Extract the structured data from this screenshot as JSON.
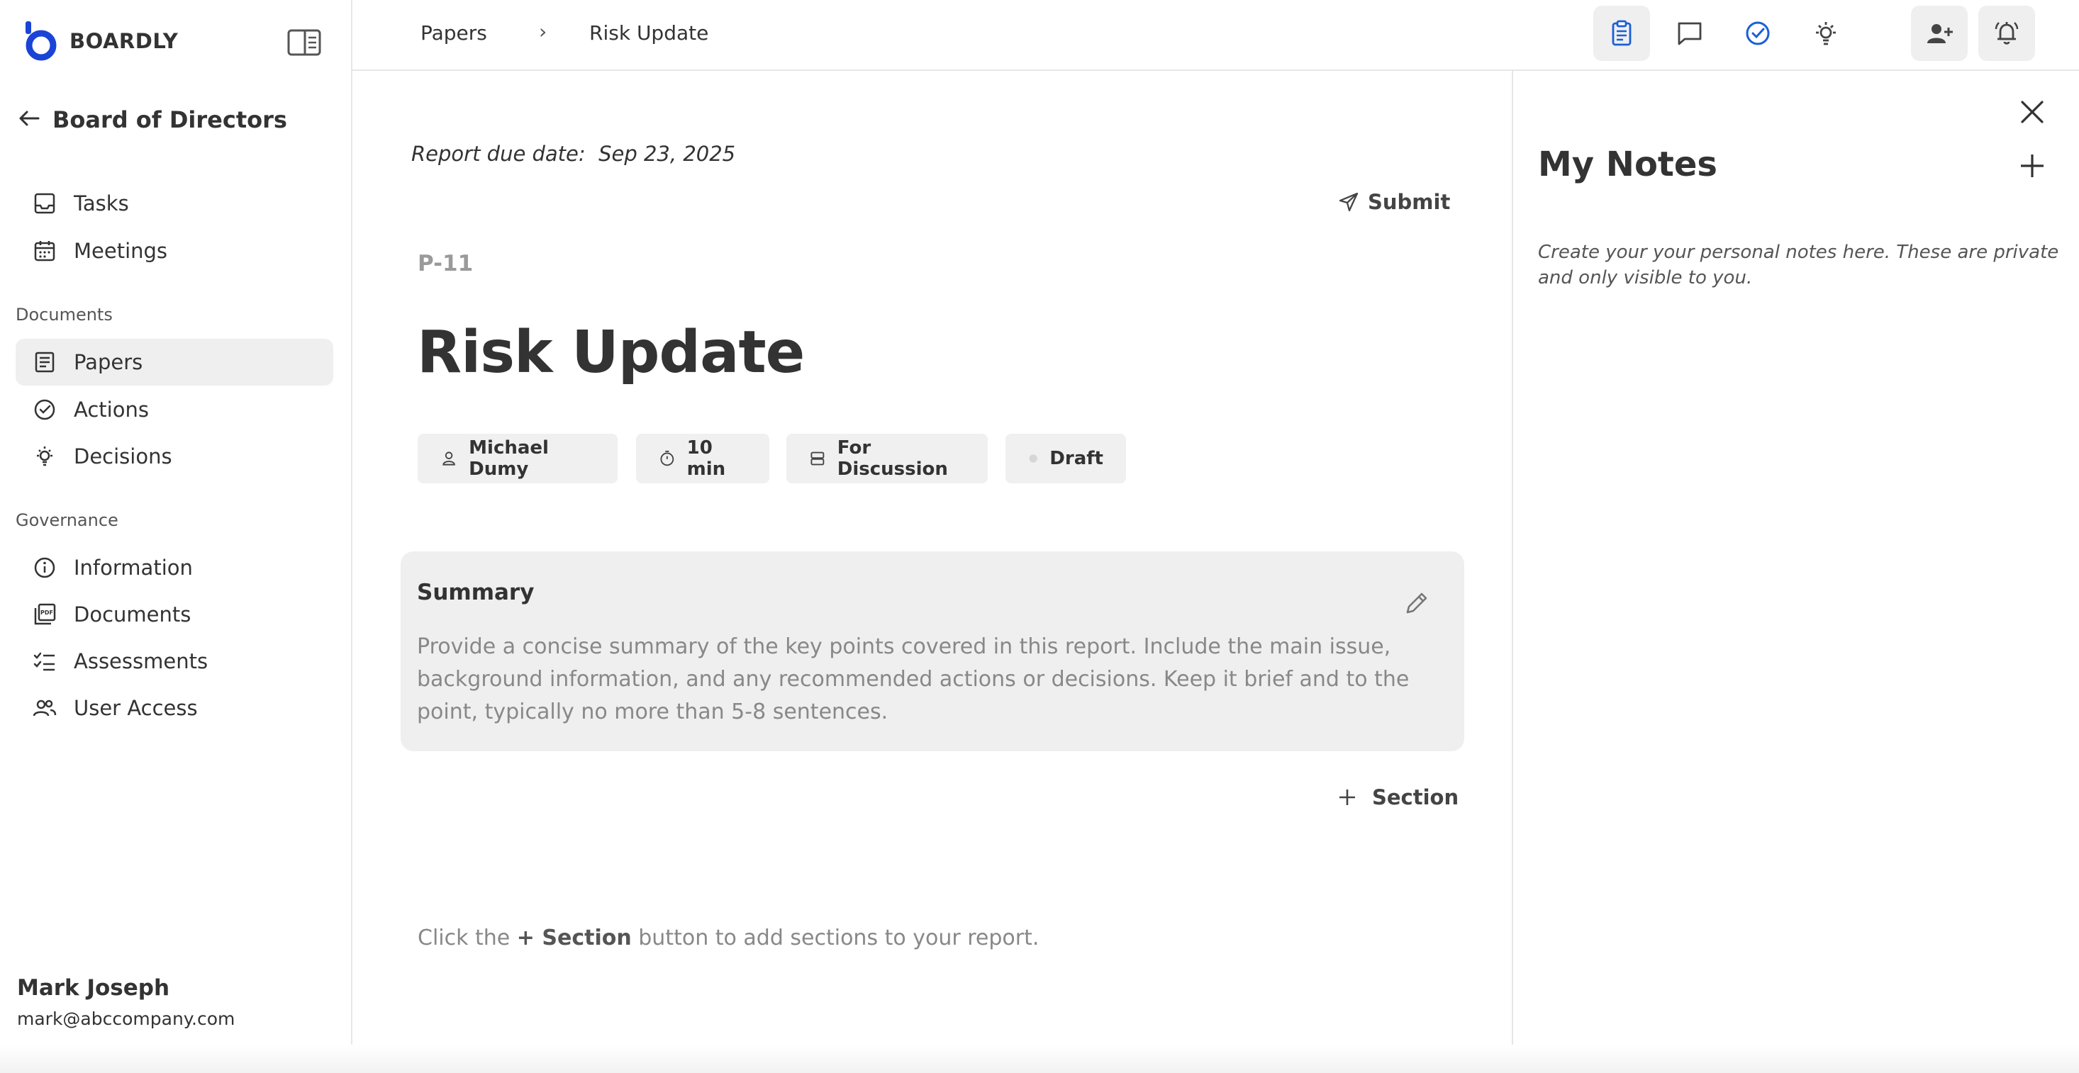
{
  "app": {
    "brand": "BOARDLY",
    "accent_color": "#1a44d6"
  },
  "sidebar": {
    "board_title": "Board of Directors",
    "top_items": [
      {
        "label": "Tasks",
        "icon": "inbox-icon"
      },
      {
        "label": "Meetings",
        "icon": "calendar-icon"
      }
    ],
    "documents_heading": "Documents",
    "document_items": [
      {
        "label": "Papers",
        "icon": "paper-icon",
        "active": true
      },
      {
        "label": "Actions",
        "icon": "check-circle-icon"
      },
      {
        "label": "Decisions",
        "icon": "lightbulb-icon"
      }
    ],
    "governance_heading": "Governance",
    "governance_items": [
      {
        "label": "Information",
        "icon": "info-icon"
      },
      {
        "label": "Documents",
        "icon": "pdf-icon"
      },
      {
        "label": "Assessments",
        "icon": "checklist-icon"
      },
      {
        "label": "User Access",
        "icon": "users-icon"
      }
    ],
    "user": {
      "name": "Mark Joseph",
      "email": "mark@abccompany.com"
    }
  },
  "breadcrumb": {
    "parent": "Papers",
    "separator": "›",
    "current": "Risk Update"
  },
  "paper": {
    "due_label": "Report due date:",
    "due_date": "Sep 23, 2025",
    "submit_label": "Submit",
    "id": "P-11",
    "title": "Risk Update",
    "chips": {
      "owner": "Michael Dumy",
      "duration": "10 min",
      "type": "For Discussion",
      "status": "Draft"
    },
    "summary_title": "Summary",
    "summary_text": "Provide a concise summary of the key points covered in this report. Include the main issue, background information, and any recommended actions or decisions. Keep it brief and to the point, typically no more than 5-8 sentences.",
    "add_section_label": "Section",
    "hint_before": "Click the ",
    "hint_bold": "+ Section",
    "hint_after": " button to add sections to your report."
  },
  "notes": {
    "title": "My Notes",
    "text": "Create your your personal notes here. These are private and only visible to you."
  }
}
